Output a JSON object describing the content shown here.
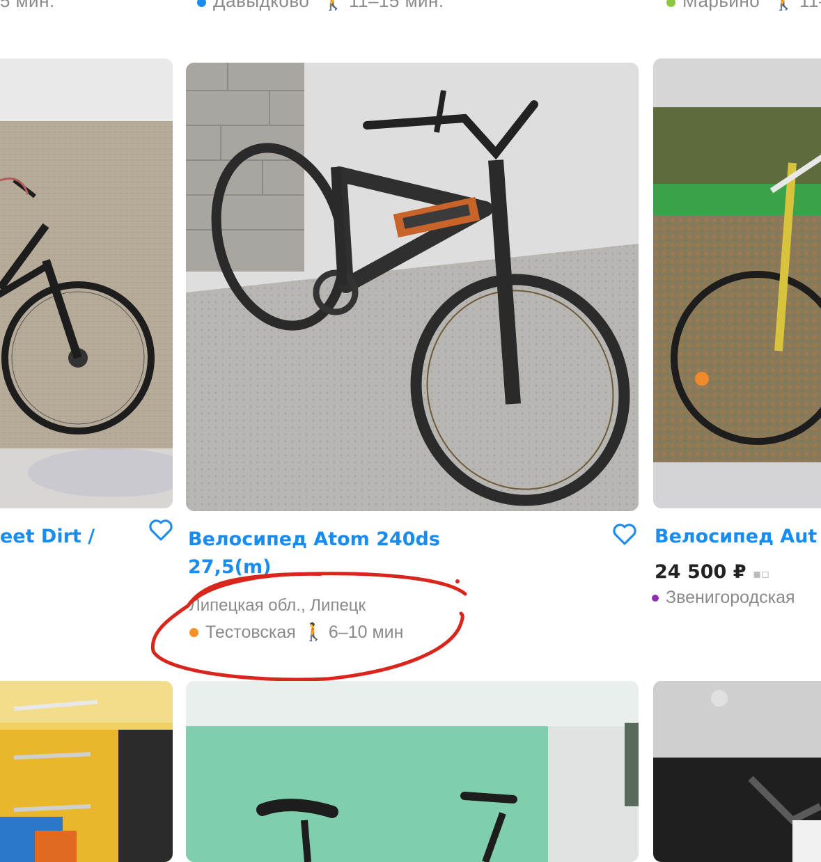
{
  "top_row": {
    "left_meta": "5 мин.",
    "center_meta": "Давыдково",
    "center_time": "11–15 мин.",
    "right_meta": "Марьино",
    "right_time": "11–",
    "colors": {
      "center_dot": "#1a8cf0",
      "right_dot": "#8dc63f"
    }
  },
  "listings": [
    {
      "title_fragment": "eet Dirt /",
      "favorite": false
    },
    {
      "title_line1": "Велосипед Atom 240ds",
      "title_line2": "27,5(m)",
      "region": "Липецкая обл., Липецк",
      "metro_station": "Тестовская",
      "metro_time": "6–10 мин",
      "metro_color": "#f2912a",
      "favorite": false
    },
    {
      "title_fragment": "Велосипед Aut",
      "price": "24 500 ₽",
      "metro_station": "Звенигородская",
      "metro_color": "#8e2fb0",
      "favorite": false
    }
  ],
  "annotation": {
    "color": "#d9261c",
    "shape": "hand-drawn ellipse around address"
  },
  "icons": {
    "favorite": "heart-outline-icon",
    "walk": "walking-person-icon",
    "delivery": "delivery-icon"
  },
  "colors": {
    "link": "#1a8cf0",
    "muted": "#8a8a8a"
  }
}
